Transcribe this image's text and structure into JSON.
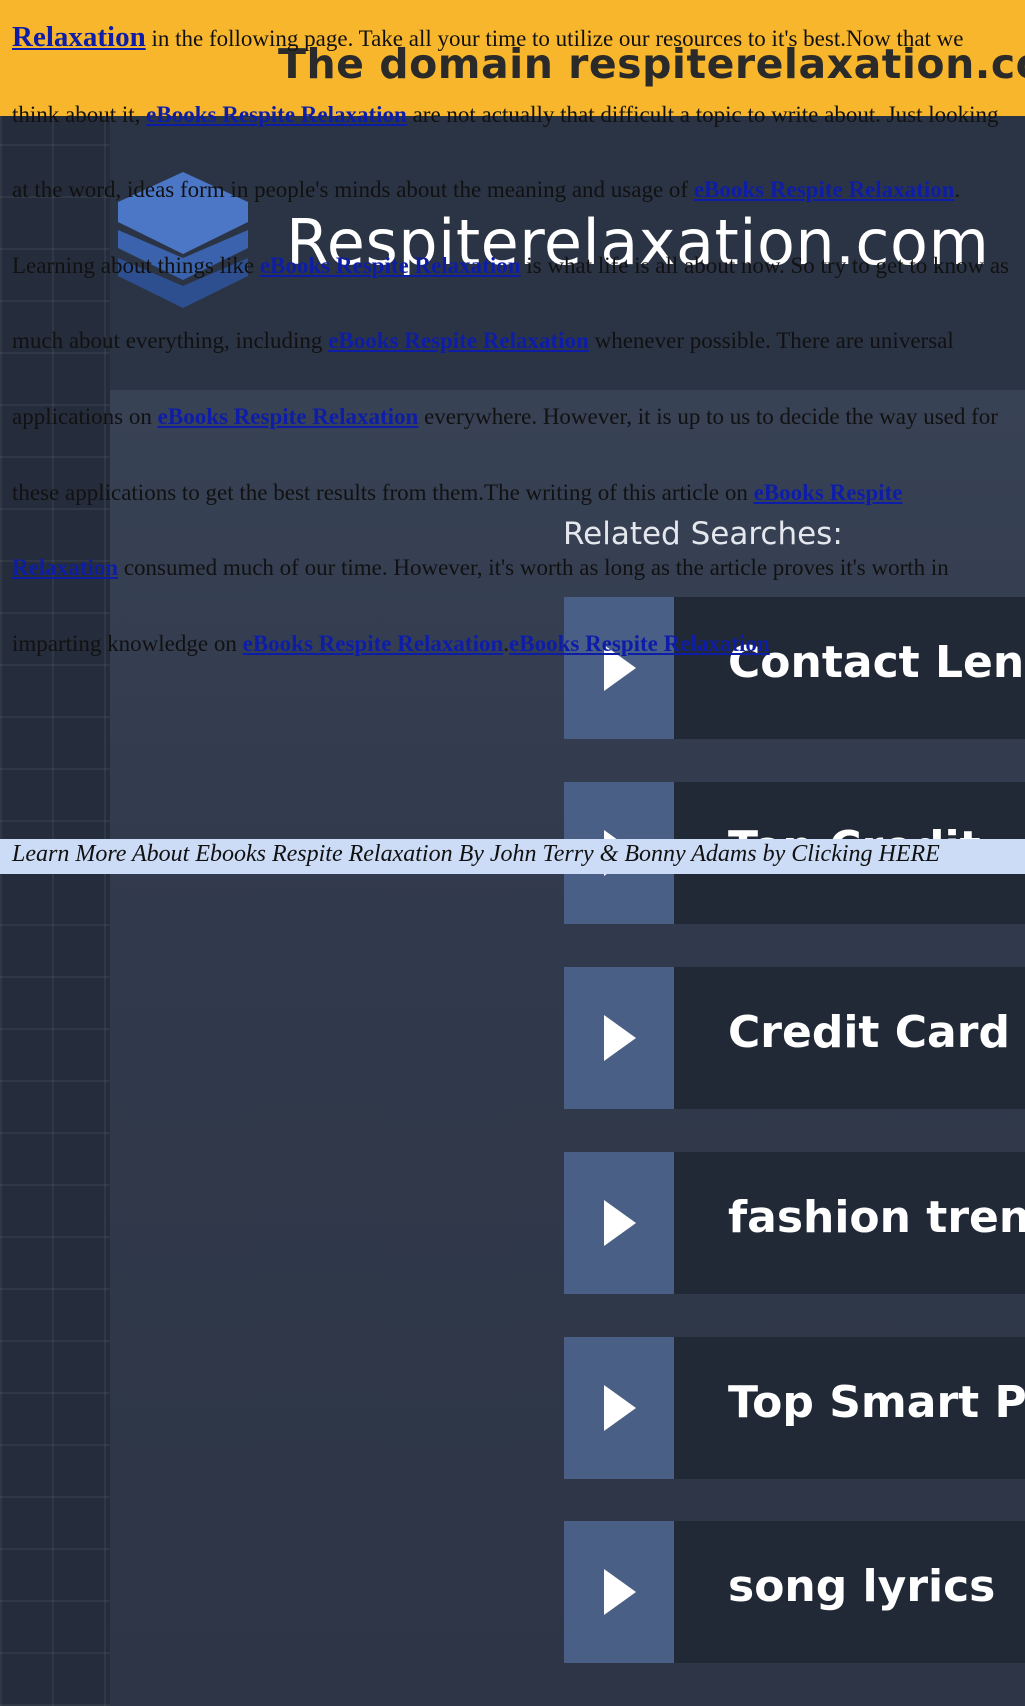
{
  "background": {
    "domain_banner": "The domain respiterelaxation.com ma",
    "site_name": "Respiterelaxation.com",
    "related_heading": "Related Searches:",
    "related_searches": [
      {
        "label": "Contact Len"
      },
      {
        "label": "Top Credit"
      },
      {
        "label": "Credit Card"
      },
      {
        "label": "fashion tren"
      },
      {
        "label": "Top Smart P"
      },
      {
        "label": "song lyrics"
      }
    ],
    "colors": {
      "banner": "#f8b62c",
      "page_bg": "#2b3445",
      "arrow_box": "#4a5f86",
      "label_box": "#222936"
    }
  },
  "article": {
    "link_text": "eBooks Respite Relaxation",
    "first_link": "Relaxation",
    "t1": " in the following page. Take all your time to utilize our resources to it's best.Now that we think about it, ",
    "t2": " are not actually that difficult a topic to write about. Just looking at the word, ideas form in people's minds about the meaning and usage of ",
    "t3": ". Learning about things like ",
    "t4": " is what life is all about now. So try to get to know as much about everything, including ",
    "t5": " whenever possible. There are universal applications on ",
    "t6": " everywhere. However, it is up to us to decide the way used for these applications to get the best results from them.The writing of this article on ",
    "t7": " consumed much of our time. However, it's worth as long as the article proves it's worth in imparting knowledge on ",
    "t8": "."
  },
  "learn_more": "Learn More About Ebooks Respite Relaxation By John Terry & Bonny Adams by Clicking HERE",
  "colors": {
    "link": "#0d1da8",
    "learn_more_bg": "#ccdcf6"
  }
}
